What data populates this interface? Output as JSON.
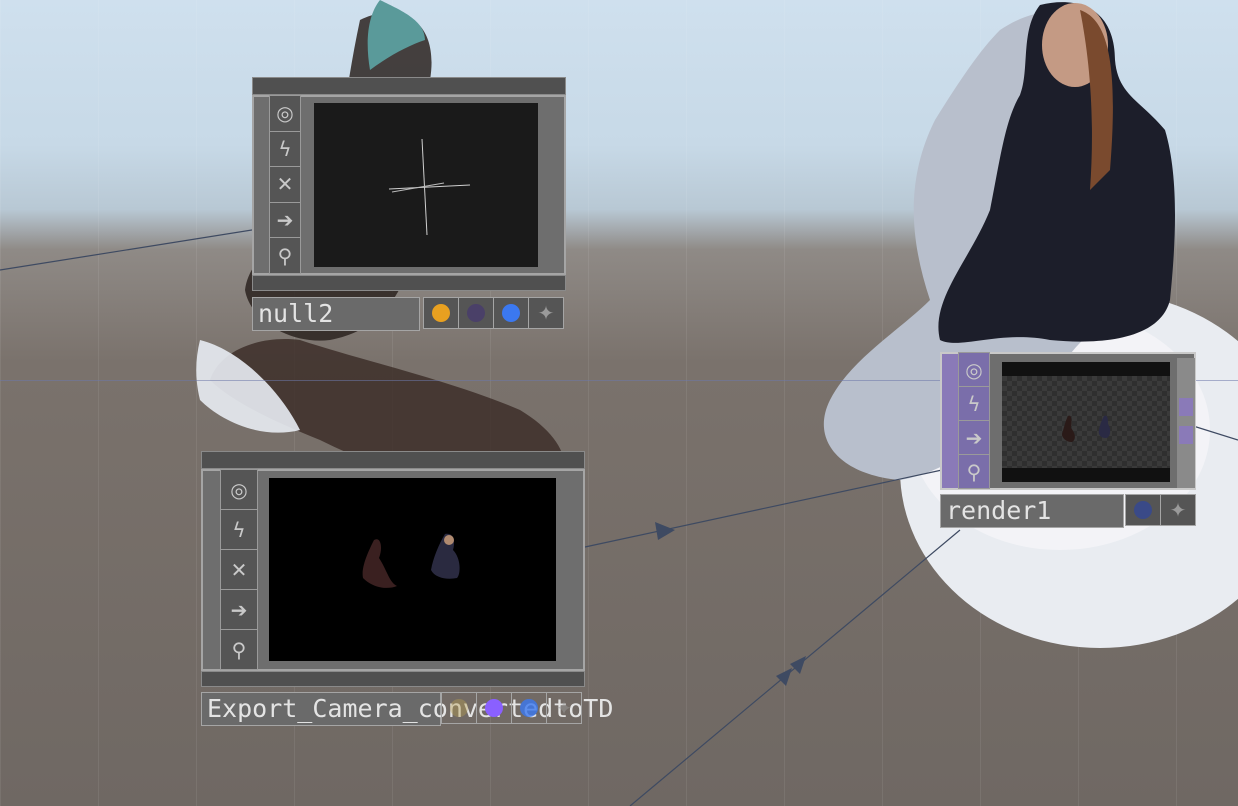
{
  "canvas": {
    "background_sky": "#cfe0ee",
    "background_floor": "#6f6863",
    "wire_color": "#4a5a78"
  },
  "nodes": {
    "null2": {
      "name": "null2",
      "side_icons": [
        "viewer-icon",
        "bypass-icon",
        "cook-icon",
        "export-icon",
        "lock-icon"
      ],
      "flags": [
        "#e8a020",
        "#4a4068",
        "#3b78f0",
        "spark"
      ]
    },
    "export_camera": {
      "name": "Export_Camera_convertedtoTD",
      "side_icons": [
        "viewer-icon",
        "bypass-icon",
        "cook-icon",
        "export-icon",
        "lock-icon"
      ],
      "flags": [
        "#b8a050",
        "#8a60ff",
        "#3b78f0",
        "spark"
      ]
    },
    "render1": {
      "name": "render1",
      "accent": "#8a7ab8",
      "side_icons": [
        "viewer-icon",
        "bypass-icon",
        "export-icon",
        "lock-icon"
      ],
      "flags": [
        "#3a4a88",
        "spark"
      ]
    }
  }
}
